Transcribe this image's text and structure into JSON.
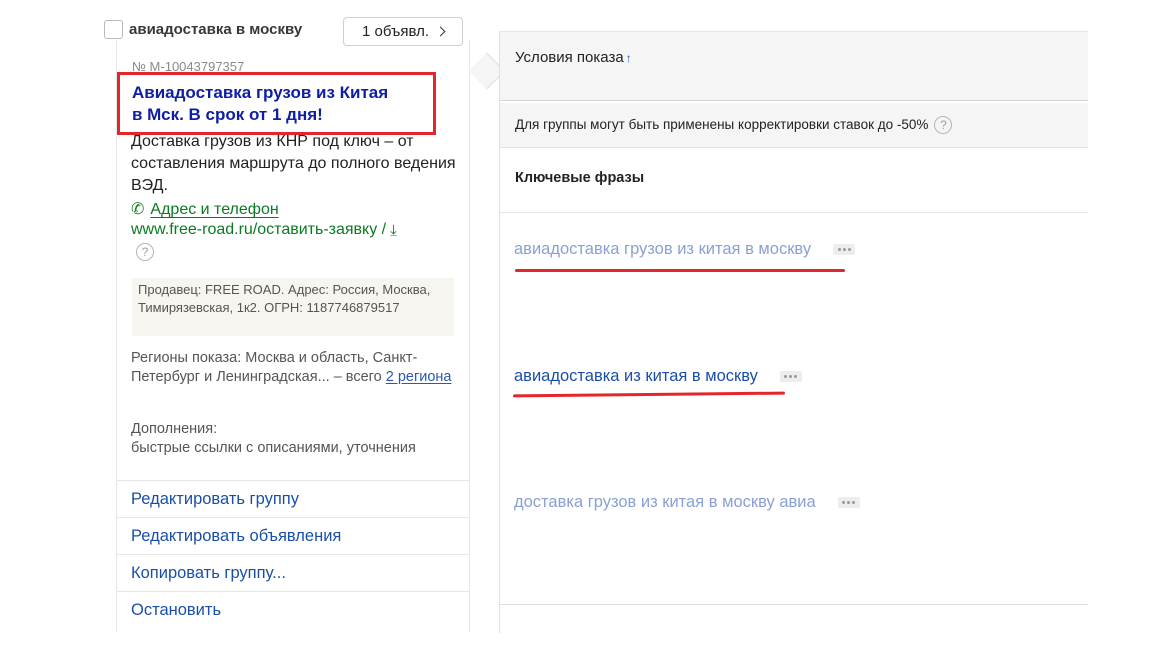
{
  "group": {
    "name": "авиадоставка в москву",
    "ads_count_label": "1 объявл."
  },
  "ad": {
    "number": "№ М-10043797357",
    "title_line1": "Авиадоставка грузов из Китая",
    "title_line2": "в Мск. В срок от 1 дня!",
    "text": "Доставка грузов из КНР под ключ – от составления маршрута до полного ведения ВЭД.",
    "contacts_label": "Адрес и телефон",
    "display_url": "www.free-road.ru/оставить-заявку /",
    "seller_info": "Продавец: FREE ROAD. Адрес: Россия, Москва, Тимирязевская, 1к2. ОГРН: 1187746879517",
    "regions_prefix": "Регионы показа: Москва и область, Санкт-Петербург и Ленинградская... – всего",
    "regions_link": "2 региона",
    "extras_label": "Дополнения:",
    "extras_value": "быстрые ссылки с описаниями, уточнения"
  },
  "actions": [
    "Редактировать группу",
    "Редактировать объявления",
    "Копировать группу...",
    "Остановить"
  ],
  "right_panel": {
    "conditions_label": "Условия показа",
    "sort_arrow": "↑",
    "bid_note": "Для группы могут быть применены корректировки ставок до -50%",
    "keywords_header": "Ключевые фразы",
    "keywords": [
      {
        "text": "авиадоставка грузов из китая в москву",
        "state": "muted"
      },
      {
        "text": "авиадоставка из китая в москву",
        "state": "active"
      },
      {
        "text": "доставка грузов из китая в москву авиа",
        "state": "muted"
      }
    ]
  },
  "icons": {
    "help": "?",
    "phone": "✆",
    "download": "⤓"
  },
  "colors": {
    "highlight_red": "#e3262c",
    "link_blue": "#1a4fa8",
    "title_blue": "#0e1ea5",
    "url_green": "#0a7a22"
  }
}
